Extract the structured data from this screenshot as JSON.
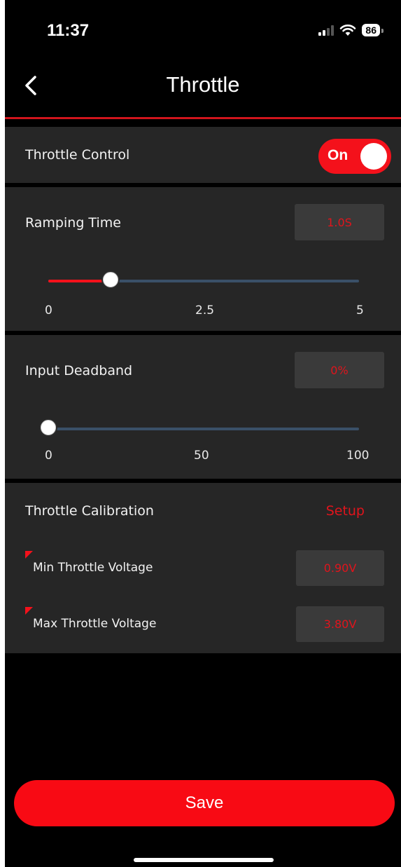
{
  "status_bar": {
    "time": "11:37",
    "battery": "86"
  },
  "nav": {
    "title": "Throttle"
  },
  "throttle_control": {
    "label": "Throttle Control",
    "toggle_label": "On",
    "enabled": true
  },
  "ramping_time": {
    "label": "Ramping Time",
    "value": "1.0S",
    "slider": {
      "min_label": "0",
      "mid_label": "2.5",
      "max_label": "5",
      "min": 0,
      "max": 5,
      "value": 1.0
    }
  },
  "input_deadband": {
    "label": "Input Deadband",
    "value": "0%",
    "slider": {
      "min_label": "0",
      "mid_label": "50",
      "max_label": "100",
      "min": 0,
      "max": 100,
      "value": 0
    }
  },
  "calibration": {
    "label": "Throttle Calibration",
    "setup_label": "Setup",
    "min_label": "Min Throttle Voltage",
    "min_value": "0.90V",
    "max_label": "Max Throttle Voltage",
    "max_value": "3.80V"
  },
  "save_label": "Save",
  "colors": {
    "accent": "#f4111b",
    "card": "#262626",
    "track": "#3a5068"
  }
}
